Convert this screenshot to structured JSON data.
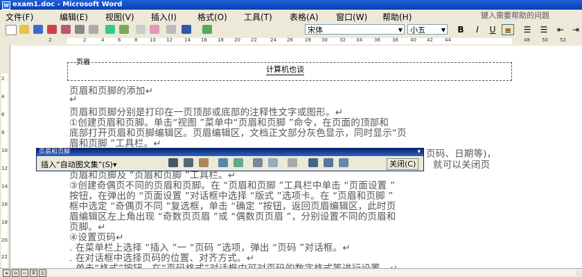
{
  "window": {
    "title": "exam1.doc - Microsoft Word"
  },
  "menu": [
    "文件(F)",
    "编辑(E)",
    "视图(V)",
    "插入(I)",
    "格式(O)",
    "工具(T)",
    "表格(A)",
    "窗口(W)",
    "帮助(H)"
  ],
  "help_placeholder": "键入需要帮助的问题",
  "toolbar": {
    "font_name": "宋体",
    "font_size": "小五",
    "bold_label": "B",
    "italic_label": "I",
    "underline_label": "U"
  },
  "ruler": {
    "h_numbers": [
      "2",
      "2",
      "4",
      "6",
      "8",
      "10",
      "12",
      "14",
      "16",
      "18",
      "20",
      "22",
      "24",
      "26",
      "28",
      "30",
      "32",
      "34",
      "36",
      "38",
      "40",
      "42",
      "44",
      "48",
      "50",
      "52"
    ],
    "v_numbers": [
      "2",
      "4",
      "6",
      "8",
      "10",
      "12",
      "14",
      "16",
      "18",
      "20",
      "22"
    ]
  },
  "header": {
    "label": "页眉",
    "text": "计算机也谈"
  },
  "body_lines": [
    "页眉和页脚的添加↵",
    "↵",
    "页眉和页脚分别是打印在一页顶部或底部的注释性文字或图形。↵",
    "①创建页眉和页脚。单击“视图 ”菜单中“页眉和页脚 ”命令，在页面的顶部和",
    "底部打开页眉和页脚编辑区。页眉编辑区，文档正文部分灰色显示，同时显示“页",
    "眉和页脚 ”工具栏。↵",
    "",
    "页眉和页脚及 “页眉和页脚 ”工具栏。↵",
    "③创建奇偶页不同的页眉和页脚。在 “页眉和页脚 ”工具栏中单击 “页面设置 ”",
    "按钮，在弹出的 “页面设置 ”对话框中选择 “版式 ”选项卡。在 “页眉和页脚 ”",
    "框中选定 “奇偶页不同 ”复选框，单击 “确定 ”按钮，返回页眉编辑区，此时页",
    "眉编辑区左上角出现 “奇数页页眉 ”或 “偶数页页眉 ”，分别设置不同的页眉和",
    "页脚。↵",
    "④设置页码↵",
    ". 在菜单栏上选择 “插入 ”一 “页码 ”选项，弹出 “页码 ”对话框。↵",
    ". 在对话框中选择页码的位置、对齐方式。↵",
    ". 单击“格式”按钮，在“页码格式”对话框中可对页码的数字格式等进行设置。↵"
  ],
  "right_fragments": {
    "line1": "页码、日期等)，",
    "line2": "就可以关闭页"
  },
  "hf_toolbar": {
    "title": "页眉和页脚",
    "insert_autotext": "插入“自动图文集”(S)▾",
    "close_label": "关闭(C)"
  }
}
